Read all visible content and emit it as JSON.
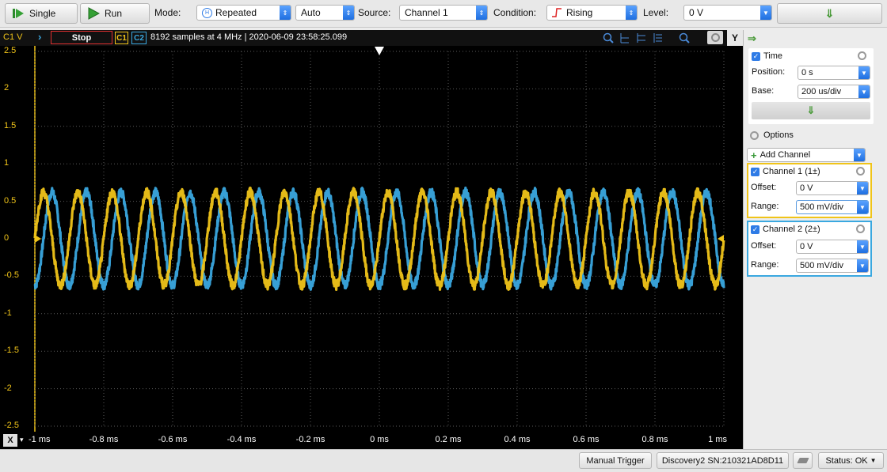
{
  "toolbar": {
    "single_label": "Single",
    "run_label": "Run",
    "mode_label": "Mode:",
    "mode_value": "Repeated",
    "trigger_mode_value": "Auto",
    "source_label": "Source:",
    "source_value": "Channel 1",
    "condition_label": "Condition:",
    "condition_value": "Rising",
    "level_label": "Level:",
    "level_value": "0 V"
  },
  "plot_header": {
    "channel_unit": "C1 V",
    "stop_label": "Stop",
    "c1_label": "C1",
    "c2_label": "C2",
    "info": "8192 samples at 4 MHz | 2020-06-09 23:58:25.099",
    "y_button": "Y"
  },
  "chart_data": {
    "type": "line",
    "x_unit": "ms",
    "y_unit": "V",
    "xlim": [
      -1,
      1
    ],
    "ylim": [
      -2.5,
      2.5
    ],
    "grid": true,
    "x_ticks": [
      "-1 ms",
      "-0.8 ms",
      "-0.6 ms",
      "-0.4 ms",
      "-0.2 ms",
      "0 ms",
      "0.2 ms",
      "0.4 ms",
      "0.6 ms",
      "0.8 ms",
      "1 ms"
    ],
    "y_ticks": [
      "2.5",
      "2",
      "1.5",
      "1",
      "0.5",
      "0",
      "-0.5",
      "-1",
      "-1.5",
      "-2",
      "-2.5"
    ],
    "series": [
      {
        "name": "C1",
        "color": "#f0c419",
        "amplitude": 0.62,
        "frequency_khz": 10,
        "phase_deg": 0,
        "noise": 0.06
      },
      {
        "name": "C2",
        "color": "#3aa8e0",
        "amplitude": 0.62,
        "frequency_khz": 10,
        "phase_deg": -90,
        "noise": 0.06
      }
    ]
  },
  "x_axis_button": "X",
  "panel": {
    "time_title": "Time",
    "position_label": "Position:",
    "position_value": "0 s",
    "base_label": "Base:",
    "base_value": "200 us/div",
    "options_label": "Options",
    "add_channel_label": "Add Channel",
    "ch1_title": "Channel 1 (1±)",
    "ch1_offset_label": "Offset:",
    "ch1_offset_value": "0 V",
    "ch1_range_label": "Range:",
    "ch1_range_value": "500 mV/div",
    "ch2_title": "Channel 2 (2±)",
    "ch2_offset_label": "Offset:",
    "ch2_offset_value": "0 V",
    "ch2_range_label": "Range:",
    "ch2_range_value": "500 mV/div"
  },
  "status": {
    "manual_trigger": "Manual Trigger",
    "device": "Discovery2 SN:210321AD8D11",
    "status_text": "Status: OK"
  },
  "colors": {
    "c1": "#f0c419",
    "c2": "#3aa8e0",
    "accent": "#2e7be6"
  }
}
